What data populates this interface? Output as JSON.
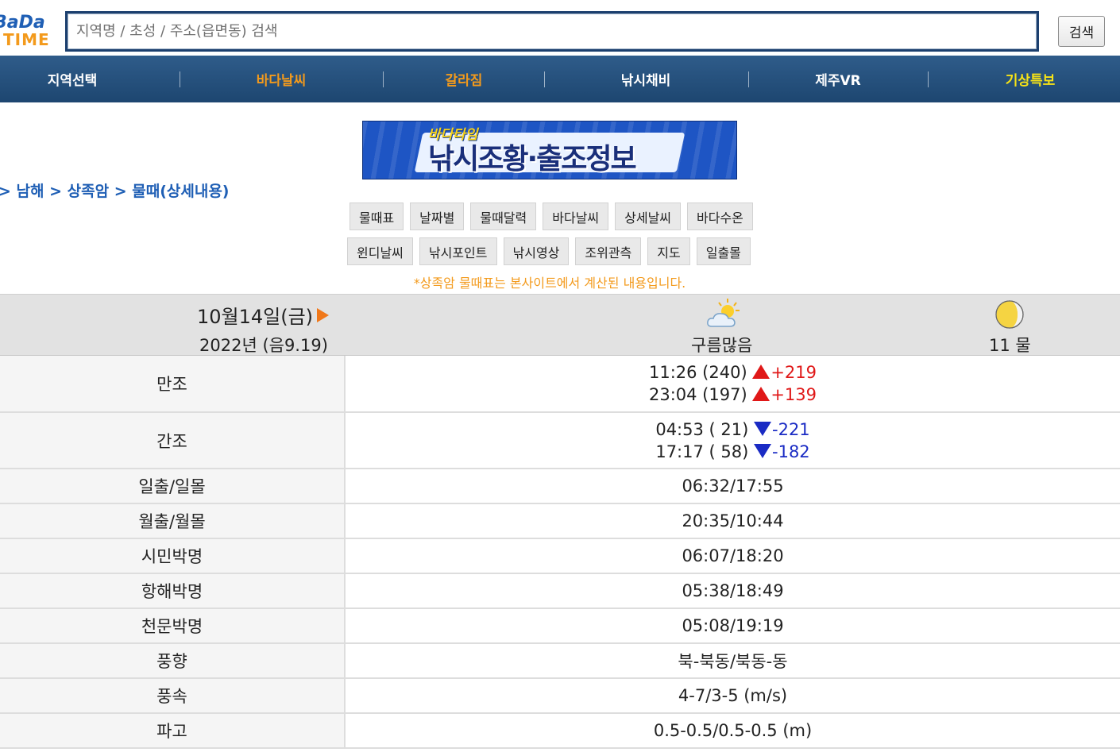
{
  "header": {
    "logo_line1": "BaDa",
    "logo_line2": "TIME",
    "search_placeholder": "지역명 / 초성 / 주소(읍면동) 검색",
    "search_button": "검색"
  },
  "nav": {
    "items": [
      {
        "label": "지역선택",
        "color": "#ffffff"
      },
      {
        "label": "바다날씨",
        "color": "#f39a1c"
      },
      {
        "label": "갈라짐",
        "color": "#f39a1c"
      },
      {
        "label": "낚시채비",
        "color": "#ffffff"
      },
      {
        "label": "제주VR",
        "color": "#ffffff"
      },
      {
        "label": "기상특보",
        "color": "#f7e316"
      }
    ]
  },
  "banner": {
    "small": "바다타임",
    "main": "낚시조황·출조정보"
  },
  "breadcrumb": "> 남해 > 상족암 > 물때(상세내용)",
  "tabs_row1": [
    "물때표",
    "날짜별",
    "물때달력",
    "바다날씨",
    "상세날씨",
    "바다수온"
  ],
  "tabs_row2": [
    "윈디날씨",
    "낚시포인트",
    "낚시영상",
    "조위관측",
    "지도",
    "일출몰"
  ],
  "notice": "*상족암 물때표는 본사이트에서 계산된 내용입니다.",
  "day": {
    "date": "10월14일(금)",
    "lunar": "2022년 (음9.19)",
    "weather": "구름많음",
    "weather_icon": "cloud-sun-icon",
    "moon_icon": "moon-phase-icon",
    "tide": "11 물"
  },
  "table": {
    "high": {
      "label": "만조",
      "rows": [
        {
          "time": "11:26 (240)",
          "diff": "+219"
        },
        {
          "time": "23:04 (197)",
          "diff": "+139"
        }
      ]
    },
    "low": {
      "label": "간조",
      "rows": [
        {
          "time": "04:53 ( 21)",
          "diff": "-221"
        },
        {
          "time": "17:17 ( 58)",
          "diff": "-182"
        }
      ]
    },
    "rows": [
      {
        "label": "일출/일몰",
        "value": "06:32/17:55"
      },
      {
        "label": "월출/월몰",
        "value": "20:35/10:44"
      },
      {
        "label": "시민박명",
        "value": "06:07/18:20"
      },
      {
        "label": "항해박명",
        "value": "05:38/18:49"
      },
      {
        "label": "천문박명",
        "value": "05:08/19:19"
      },
      {
        "label": "풍향",
        "value": "북-북동/북동-동"
      },
      {
        "label": "풍속",
        "value": "4-7/3-5 (m/s)"
      },
      {
        "label": "파고",
        "value": "0.5-0.5/0.5-0.5 (m)"
      }
    ]
  },
  "colors": {
    "nav_bg": "#1d4670",
    "rise": "#e01818",
    "fall": "#1a2bc4",
    "notice": "#f39a1c",
    "link": "#1f5fb5"
  }
}
